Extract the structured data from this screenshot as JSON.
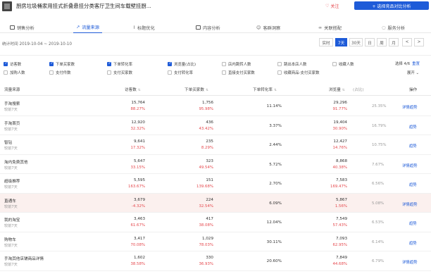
{
  "header": {
    "title": "厨房垃圾桶家用挂式折叠悬挂分类客厅卫生间车载壁挂厨...",
    "follow_label": "关注",
    "compare_label": "+ 选择竞品对比分析"
  },
  "tabs": [
    {
      "label": "销售分析"
    },
    {
      "label": "流量来源"
    },
    {
      "label": "标题优化"
    },
    {
      "label": "内容分析"
    },
    {
      "label": "客群洞察"
    },
    {
      "label": "关联搭配"
    },
    {
      "label": "服务分析"
    }
  ],
  "stats": {
    "time_label": "统计时间 2019-10-04 ~ 2019-10-10",
    "range_buttons": [
      {
        "label": "实时",
        "active": false
      },
      {
        "label": "7天",
        "active": true
      },
      {
        "label": "30天",
        "active": false
      },
      {
        "label": "日",
        "active": false
      },
      {
        "label": "周",
        "active": false
      },
      {
        "label": "月",
        "active": false
      },
      {
        "label": "<",
        "active": false
      },
      {
        "label": ">",
        "active": false
      }
    ]
  },
  "metrics": {
    "row1": [
      {
        "label": "访客数",
        "checked": true
      },
      {
        "label": "下单买家数",
        "checked": true
      },
      {
        "label": "下单转化率",
        "checked": true
      },
      {
        "label": "浏览量(占比)",
        "checked": true
      },
      {
        "label": "店内跳转人数",
        "checked": false
      },
      {
        "label": "跳出本店人数",
        "checked": false
      },
      {
        "label": "收藏人数",
        "checked": false
      }
    ],
    "row2": [
      {
        "label": "加购人数",
        "checked": false
      },
      {
        "label": "支付件数",
        "checked": false
      },
      {
        "label": "支付买家数",
        "checked": false
      },
      {
        "label": "支付转化率",
        "checked": false
      },
      {
        "label": "直接支付买家数",
        "checked": false
      },
      {
        "label": "收藏商品-支付买家数",
        "checked": false
      }
    ],
    "selected_text": "选择 4/6",
    "reset_label": "重置",
    "expand_label": "展开 ⌄"
  },
  "table": {
    "headers": [
      "流量来源",
      "访客数",
      "下单买家数",
      "下单转化率",
      "浏览量",
      "(占比)",
      "操作"
    ],
    "rows": [
      {
        "source": "手淘搜索",
        "sub": "较前7天",
        "visitors": "15,764",
        "visitors_pct": "88.27%",
        "buyers": "1,756",
        "buyers_pct": "95.98%",
        "conv": "11.14%",
        "pv": "29,296",
        "pv_pct": "91.77%",
        "share": "25.35%",
        "action": "详情|趋势"
      },
      {
        "source": "手淘首页",
        "sub": "较前7天",
        "visitors": "12,920",
        "visitors_pct": "32.32%",
        "buyers": "436",
        "buyers_pct": "43.42%",
        "conv": "3.37%",
        "pv": "19,404",
        "pv_pct": "30.90%",
        "share": "16.79%",
        "action": "趋势"
      },
      {
        "source": "智钻",
        "sub": "较前7天",
        "visitors": "9,641",
        "visitors_pct": "17.32%",
        "buyers": "235",
        "buyers_pct": "8.29%",
        "conv": "2.44%",
        "pv": "12,427",
        "pv_pct": "14.76%",
        "share": "10.75%",
        "action": "趋势"
      },
      {
        "source": "淘内免费其他",
        "sub": "较前7天",
        "visitors": "5,647",
        "visitors_pct": "33.15%",
        "buyers": "323",
        "buyers_pct": "49.54%",
        "conv": "5.72%",
        "pv": "8,868",
        "pv_pct": "40.38%",
        "share": "7.67%",
        "action": "详情|趋势"
      },
      {
        "source": "超级推荐",
        "sub": "较前7天",
        "visitors": "5,595",
        "visitors_pct": "163.67%",
        "buyers": "151",
        "buyers_pct": "139.68%",
        "conv": "2.70%",
        "pv": "7,583",
        "pv_pct": "169.47%",
        "share": "6.56%",
        "action": "趋势"
      },
      {
        "source": "直通车",
        "sub": "较前7天",
        "visitors": "3,679",
        "visitors_pct": "-4.32%",
        "buyers": "224",
        "buyers_pct": "32.54%",
        "conv": "6.09%",
        "pv": "5,867",
        "pv_pct": "1.56%",
        "share": "5.08%",
        "action": "详情|趋势"
      },
      {
        "source": "我的淘宝",
        "sub": "较前7天",
        "visitors": "3,463",
        "visitors_pct": "61.67%",
        "buyers": "417",
        "buyers_pct": "38.08%",
        "conv": "12.04%",
        "pv": "7,549",
        "pv_pct": "57.43%",
        "share": "6.53%",
        "action": "趋势"
      },
      {
        "source": "购物车",
        "sub": "较前7天",
        "visitors": "3,417",
        "visitors_pct": "70.08%",
        "buyers": "1,029",
        "buyers_pct": "78.03%",
        "conv": "30.11%",
        "pv": "7,093",
        "pv_pct": "62.95%",
        "share": "6.14%",
        "action": "趋势"
      },
      {
        "source": "手淘其他店铺商品详情",
        "sub": "较前7天",
        "visitors": "1,602",
        "visitors_pct": "38.58%",
        "buyers": "330",
        "buyers_pct": "36.93%",
        "conv": "20.60%",
        "pv": "7,849",
        "pv_pct": "44.68%",
        "share": "6.79%",
        "action": "详情|趋势"
      }
    ]
  }
}
